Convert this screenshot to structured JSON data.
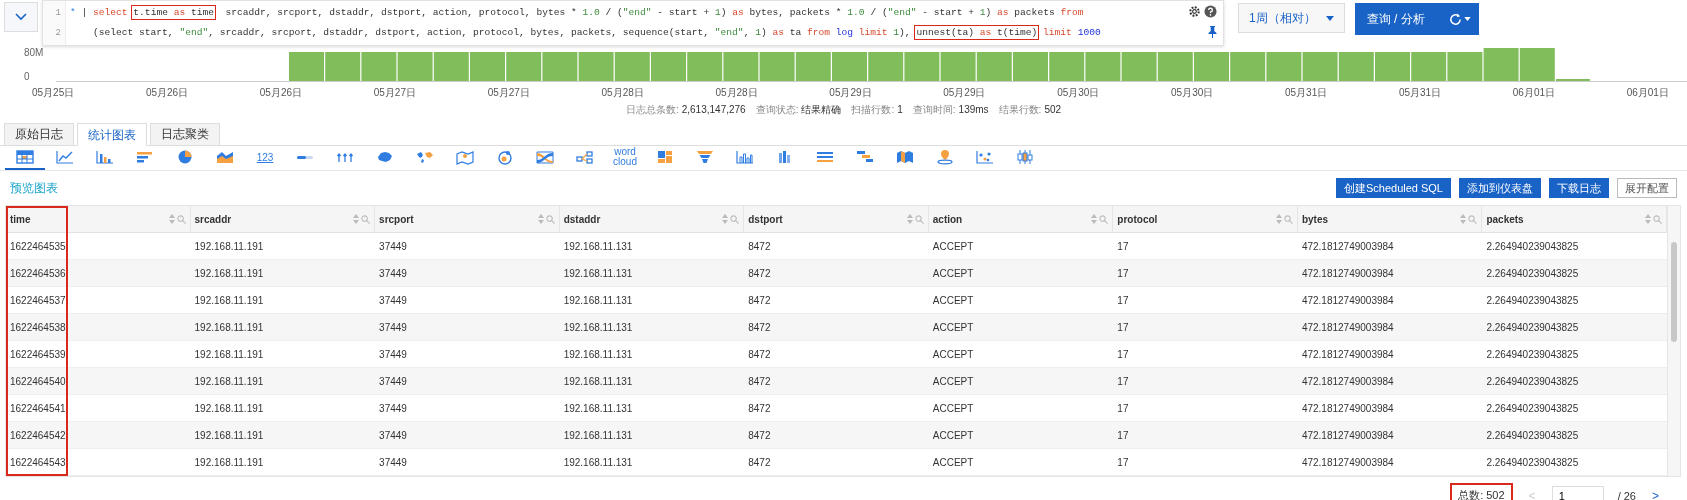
{
  "query": {
    "lines": [
      {
        "number": "1",
        "segments": [
          {
            "kind": "op",
            "text": "*"
          },
          {
            "kind": "plain",
            "text": " | "
          },
          {
            "kind": "kw",
            "text": "select "
          },
          {
            "boxed": true,
            "parts": [
              {
                "kind": "plain",
                "text": "t.time "
              },
              {
                "kind": "kw",
                "text": "as"
              },
              {
                "kind": "plain",
                "text": " time"
              }
            ]
          },
          {
            "kind": "plain",
            "text": "  srcaddr, srcport, dstaddr, dstport, action, protocol, bytes * "
          },
          {
            "kind": "num",
            "text": "1.0"
          },
          {
            "kind": "plain",
            "text": " / ("
          },
          {
            "kind": "str",
            "text": "\"end\""
          },
          {
            "kind": "plain",
            "text": " - start + "
          },
          {
            "kind": "num",
            "text": "1"
          },
          {
            "kind": "plain",
            "text": ") "
          },
          {
            "kind": "kw",
            "text": "as"
          },
          {
            "kind": "plain",
            "text": " bytes, packets * "
          },
          {
            "kind": "num",
            "text": "1.0"
          },
          {
            "kind": "plain",
            "text": " / ("
          },
          {
            "kind": "str",
            "text": "\"end\""
          },
          {
            "kind": "plain",
            "text": " - start + "
          },
          {
            "kind": "num",
            "text": "1"
          },
          {
            "kind": "plain",
            "text": ") "
          },
          {
            "kind": "kw",
            "text": "as"
          },
          {
            "kind": "plain",
            "text": " packets "
          },
          {
            "kind": "kw",
            "text": "from"
          }
        ]
      },
      {
        "number": "2",
        "segments": [
          {
            "kind": "plain",
            "text": "    (select start, "
          },
          {
            "kind": "str",
            "text": "\"end\""
          },
          {
            "kind": "plain",
            "text": ", srcaddr, srcport, dstaddr, dstport, action, protocol, bytes, packets, sequence(start, "
          },
          {
            "kind": "str",
            "text": "\"end\""
          },
          {
            "kind": "plain",
            "text": ", "
          },
          {
            "kind": "num",
            "text": "1"
          },
          {
            "kind": "plain",
            "text": ") "
          },
          {
            "kind": "kw",
            "text": "as"
          },
          {
            "kind": "plain",
            "text": " ta "
          },
          {
            "kind": "kw",
            "text": "from "
          },
          {
            "kind": "tbl",
            "text": "log "
          },
          {
            "kind": "kw",
            "text": "limit "
          },
          {
            "kind": "num",
            "text": "1"
          },
          {
            "kind": "plain",
            "text": "), "
          },
          {
            "boxed": true,
            "parts": [
              {
                "kind": "plain",
                "text": "unnest(ta) "
              },
              {
                "kind": "kw",
                "text": "as"
              },
              {
                "kind": "plain",
                "text": " t(time)"
              }
            ]
          },
          {
            "kind": "kw",
            "text": " limit "
          },
          {
            "kind": "tbl",
            "text": "1000"
          }
        ]
      }
    ]
  },
  "time_range": "1周（相对）",
  "search_button": "查询 / 分析",
  "histogram": {
    "y_labels": [
      "80M",
      "0"
    ],
    "x_labels": [
      "05月25日",
      "05月26日",
      "05月26日",
      "05月27日",
      "05月27日",
      "05月28日",
      "05月28日",
      "05月29日",
      "05月29日",
      "05月30日",
      "05月30日",
      "05月31日",
      "05月31日",
      "06月01日",
      "06月01日"
    ]
  },
  "stats": [
    {
      "label": "日志总条数:",
      "value": "2,613,147,276"
    },
    {
      "label": "查询状态:",
      "value": "结果精确"
    },
    {
      "label": "扫描行数:",
      "value": "1"
    },
    {
      "label": "查询时间:",
      "value": "139ms"
    },
    {
      "label": "结果行数:",
      "value": "502"
    }
  ],
  "tabs": [
    {
      "label": "原始日志",
      "selected": false
    },
    {
      "label": "统计图表",
      "selected": true
    },
    {
      "label": "日志聚类",
      "selected": false
    }
  ],
  "chart_types": [
    {
      "kind": "table",
      "selected": true
    },
    {
      "kind": "line",
      "selected": false
    },
    {
      "kind": "bar",
      "selected": false
    },
    {
      "kind": "hbar",
      "selected": false
    },
    {
      "kind": "pie",
      "selected": false
    },
    {
      "kind": "area",
      "selected": false
    },
    {
      "kind": "number",
      "label": "123",
      "selected": false
    },
    {
      "kind": "progress",
      "selected": false
    },
    {
      "kind": "flow",
      "selected": false
    },
    {
      "kind": "china-map",
      "selected": false
    },
    {
      "kind": "world-map",
      "selected": false
    },
    {
      "kind": "map-pin",
      "selected": false
    },
    {
      "kind": "heatmap",
      "selected": false
    },
    {
      "kind": "sankey",
      "selected": false
    },
    {
      "kind": "topology",
      "selected": false
    },
    {
      "kind": "word-cloud",
      "label": "word cloud",
      "selected": false
    },
    {
      "kind": "treemap",
      "selected": false
    },
    {
      "kind": "funnel",
      "selected": false
    },
    {
      "kind": "histogram",
      "selected": false
    },
    {
      "kind": "column",
      "selected": false
    },
    {
      "kind": "list",
      "selected": false
    },
    {
      "kind": "gantt",
      "selected": false
    },
    {
      "kind": "block-map",
      "selected": false
    },
    {
      "kind": "location",
      "selected": false
    },
    {
      "kind": "scatter",
      "selected": false
    },
    {
      "kind": "boxplot",
      "selected": false
    }
  ],
  "preview_title": "预览图表",
  "actions": [
    {
      "label": "创建Scheduled SQL",
      "kind": "primary"
    },
    {
      "label": "添加到仪表盘",
      "kind": "primary"
    },
    {
      "label": "下载日志",
      "kind": "primary"
    },
    {
      "label": "展开配置",
      "kind": "default"
    }
  ],
  "table": {
    "columns": [
      {
        "name": "time",
        "highlighted": true
      },
      {
        "name": "srcaddr",
        "highlighted": false
      },
      {
        "name": "srcport",
        "highlighted": false
      },
      {
        "name": "dstaddr",
        "highlighted": false
      },
      {
        "name": "dstport",
        "highlighted": false
      },
      {
        "name": "action",
        "highlighted": false
      },
      {
        "name": "protocol",
        "highlighted": false
      },
      {
        "name": "bytes",
        "highlighted": false
      },
      {
        "name": "packets",
        "highlighted": false
      }
    ],
    "rows": [
      [
        "1622464535",
        "192.168.11.191",
        "37449",
        "192.168.11.131",
        "8472",
        "ACCEPT",
        "17",
        "472.1812749003984",
        "2.264940239043825"
      ],
      [
        "1622464536",
        "192.168.11.191",
        "37449",
        "192.168.11.131",
        "8472",
        "ACCEPT",
        "17",
        "472.1812749003984",
        "2.264940239043825"
      ],
      [
        "1622464537",
        "192.168.11.191",
        "37449",
        "192.168.11.131",
        "8472",
        "ACCEPT",
        "17",
        "472.1812749003984",
        "2.264940239043825"
      ],
      [
        "1622464538",
        "192.168.11.191",
        "37449",
        "192.168.11.131",
        "8472",
        "ACCEPT",
        "17",
        "472.1812749003984",
        "2.264940239043825"
      ],
      [
        "1622464539",
        "192.168.11.191",
        "37449",
        "192.168.11.131",
        "8472",
        "ACCEPT",
        "17",
        "472.1812749003984",
        "2.264940239043825"
      ],
      [
        "1622464540",
        "192.168.11.191",
        "37449",
        "192.168.11.131",
        "8472",
        "ACCEPT",
        "17",
        "472.1812749003984",
        "2.264940239043825"
      ],
      [
        "1622464541",
        "192.168.11.191",
        "37449",
        "192.168.11.131",
        "8472",
        "ACCEPT",
        "17",
        "472.1812749003984",
        "2.264940239043825"
      ],
      [
        "1622464542",
        "192.168.11.191",
        "37449",
        "192.168.11.131",
        "8472",
        "ACCEPT",
        "17",
        "472.1812749003984",
        "2.264940239043825"
      ],
      [
        "1622464543",
        "192.168.11.191",
        "37449",
        "192.168.11.131",
        "8472",
        "ACCEPT",
        "17",
        "472.1812749003984",
        "2.264940239043825"
      ]
    ]
  },
  "pagination": {
    "total": {
      "text": "总数: 502",
      "highlighted": true
    },
    "page": "1",
    "pages": "/ 26",
    "prev": "<",
    "next": ">",
    "prev_disabled": true
  }
}
